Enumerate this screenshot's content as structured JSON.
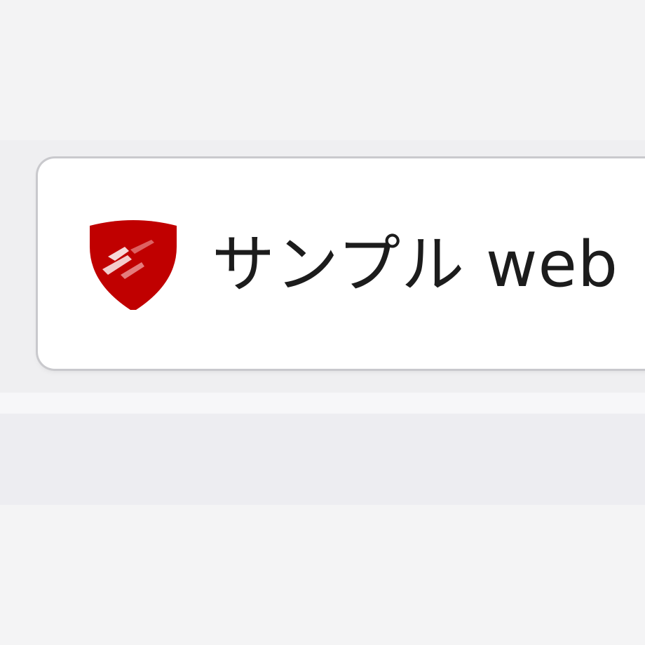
{
  "tab": {
    "title": "サンプル web",
    "favicon": "red-shield-icon"
  },
  "colors": {
    "favicon_red": "#c00000",
    "tab_background": "#ffffff",
    "chrome_background": "#f3f3f4"
  }
}
